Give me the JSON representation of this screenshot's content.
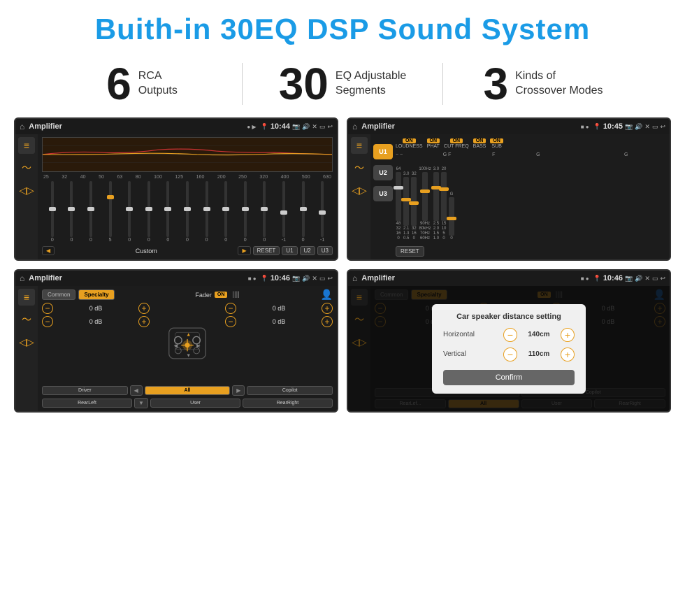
{
  "header": {
    "title": "Buith-in 30EQ DSP Sound System"
  },
  "stats": [
    {
      "number": "6",
      "text_line1": "RCA",
      "text_line2": "Outputs"
    },
    {
      "number": "30",
      "text_line1": "EQ Adjustable",
      "text_line2": "Segments"
    },
    {
      "number": "3",
      "text_line1": "Kinds of",
      "text_line2": "Crossover Modes"
    }
  ],
  "screen1": {
    "app": "Amplifier",
    "time": "10:44",
    "preset": "Custom",
    "buttons": [
      "RESET",
      "U1",
      "U2",
      "U3"
    ],
    "freq_labels": [
      "25",
      "32",
      "40",
      "50",
      "63",
      "80",
      "100",
      "125",
      "160",
      "200",
      "250",
      "320",
      "400",
      "500",
      "630"
    ],
    "slider_vals": [
      "0",
      "0",
      "0",
      "5",
      "0",
      "0",
      "0",
      "0",
      "0",
      "0",
      "0",
      "0",
      "-1",
      "0",
      "-1"
    ]
  },
  "screen2": {
    "app": "Amplifier",
    "time": "10:45",
    "u_buttons": [
      "U1",
      "U2",
      "U3"
    ],
    "toggles": [
      "LOUDNESS",
      "PHAT",
      "CUT FREQ",
      "BASS",
      "SUB"
    ],
    "reset_label": "RESET"
  },
  "screen3": {
    "app": "Amplifier",
    "time": "10:46",
    "tabs": [
      "Common",
      "Specialty"
    ],
    "fader_label": "Fader",
    "on_label": "ON",
    "vol_rows": [
      {
        "label": "0 dB"
      },
      {
        "label": "0 dB"
      },
      {
        "label": "0 dB"
      },
      {
        "label": "0 dB"
      }
    ],
    "buttons": {
      "driver": "Driver",
      "copilot": "Copilot",
      "rear_left": "RearLeft",
      "all": "All",
      "user": "User",
      "rear_right": "RearRight"
    }
  },
  "screen4": {
    "app": "Amplifier",
    "time": "10:46",
    "tabs": [
      "Common",
      "Specialty"
    ],
    "dialog": {
      "title": "Car speaker distance setting",
      "horizontal_label": "Horizontal",
      "horizontal_value": "140cm",
      "vertical_label": "Vertical",
      "vertical_value": "110cm",
      "confirm_label": "Confirm"
    },
    "buttons": {
      "driver": "Driver",
      "copilot": "Copilot",
      "rear_left": "RearLef...",
      "all": "All",
      "user": "User",
      "rear_right": "RearRight"
    }
  }
}
